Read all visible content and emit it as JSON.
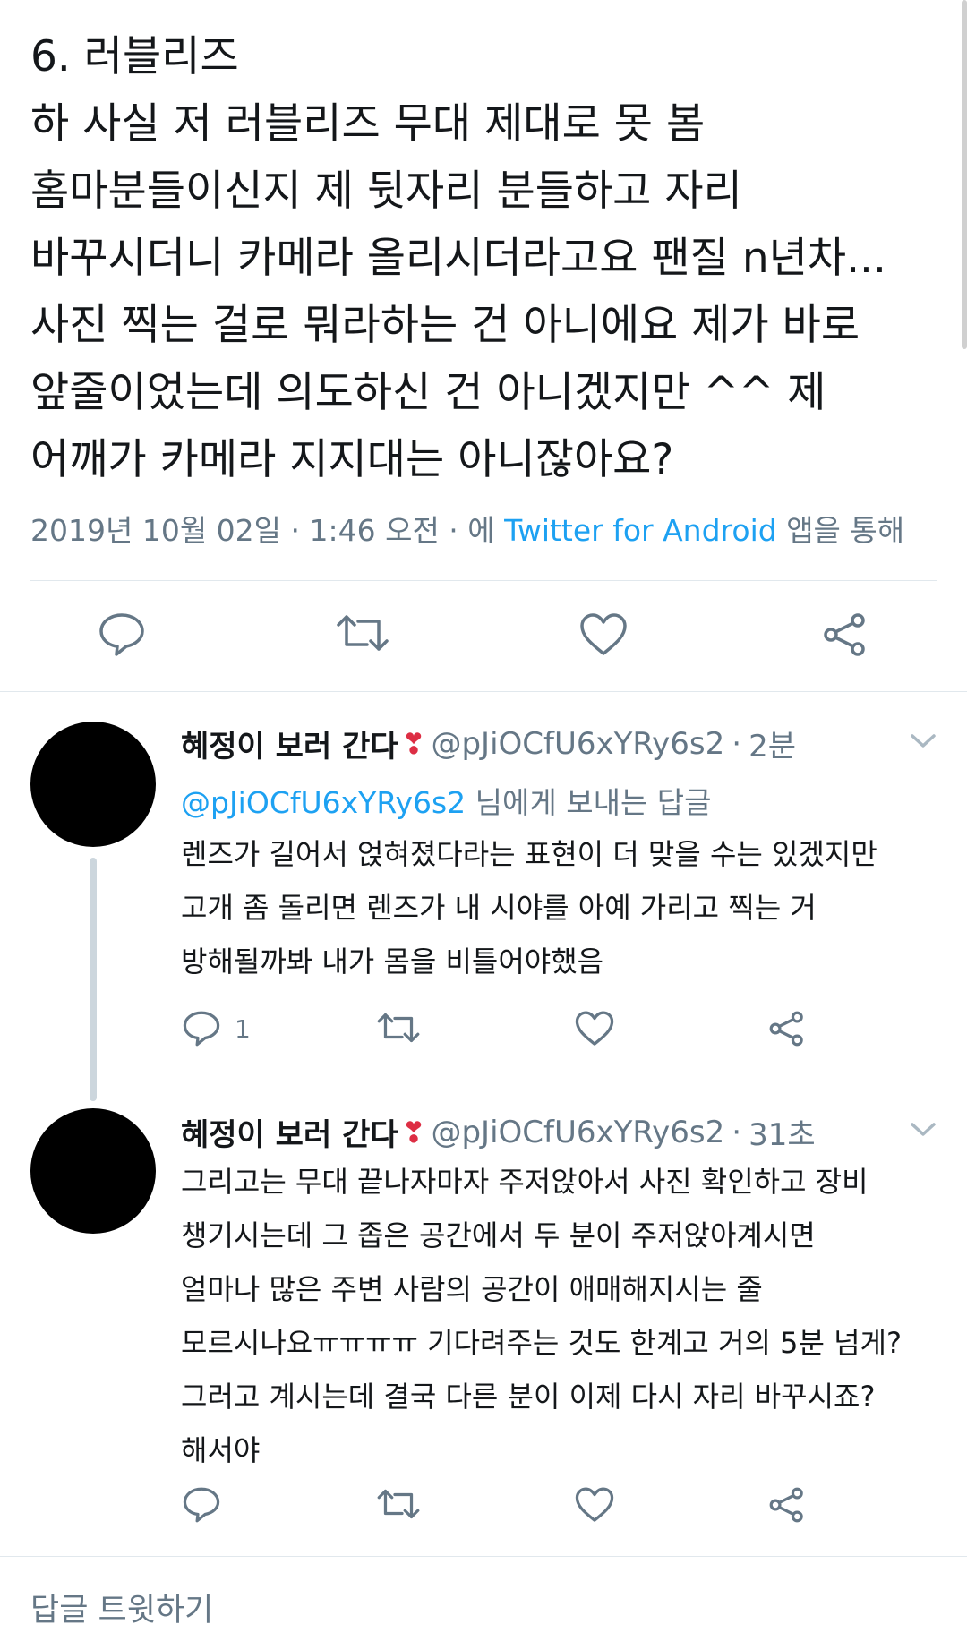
{
  "main_tweet": {
    "text": "6. 러블리즈\n하 사실 저 러블리즈 무대 제대로 못 봄\n홈마분들이신지 제 뒷자리 분들하고 자리\n바꾸시더니 카메라 올리시더라고요 팬질 n년차...\n사진 찍는 걸로 뭐라하는 건 아니에요 제가 바로\n앞줄이었는데 의도하신 건 아니겠지만 ^^ 제\n어깨가 카메라 지지대는 아니잖아요?",
    "timestamp": "2019년 10월 02일 · 1:46 오전 · 에",
    "source": "Twitter for Android",
    "source_suffix": "앱을 통해"
  },
  "replies": [
    {
      "name": "혜정이 보러 간다",
      "emoji": "❣",
      "handle": "@pJiOCfU6xYRy6s2",
      "dot": "·",
      "time": "2분",
      "reply_to_mention": "@pJiOCfU6xYRy6s2",
      "reply_to_suffix": "님에게 보내는 답글",
      "text": "렌즈가 길어서 얹혀졌다라는 표현이 더 맞을 수는 있겠지만\n고개 좀 돌리면 렌즈가 내 시야를 아예 가리고 찍는 거\n방해될까봐 내가 몸을 비틀어야했음",
      "reply_count": "1"
    },
    {
      "name": "혜정이 보러 간다",
      "emoji": "❣",
      "handle": "@pJiOCfU6xYRy6s2",
      "dot": "·",
      "time": "31초",
      "text": "그리고는 무대 끝나자마자 주저앉아서 사진 확인하고 장비\n챙기시는데 그 좁은 공간에서 두 분이 주저앉아계시면\n얼마나 많은 주변 사람의 공간이 애매해지시는 줄\n모르시나요ㅠㅠㅠㅠ 기다려주는 것도 한계고 거의 5분 넘게?\n그러고 계시는데 결국 다른 분이 이제 다시 자리 바꾸시죠?\n해서야"
    }
  ],
  "compose": {
    "placeholder": "답글 트윗하기"
  },
  "icons": {
    "reply": "reply-icon",
    "retweet": "retweet-icon",
    "like": "like-icon",
    "share": "share-icon",
    "chevron": "chevron-down-icon"
  },
  "colors": {
    "text": "#14171a",
    "muted": "#657786",
    "link": "#1da1f2",
    "divider": "#e1e8ed",
    "avatar": "#000000"
  }
}
